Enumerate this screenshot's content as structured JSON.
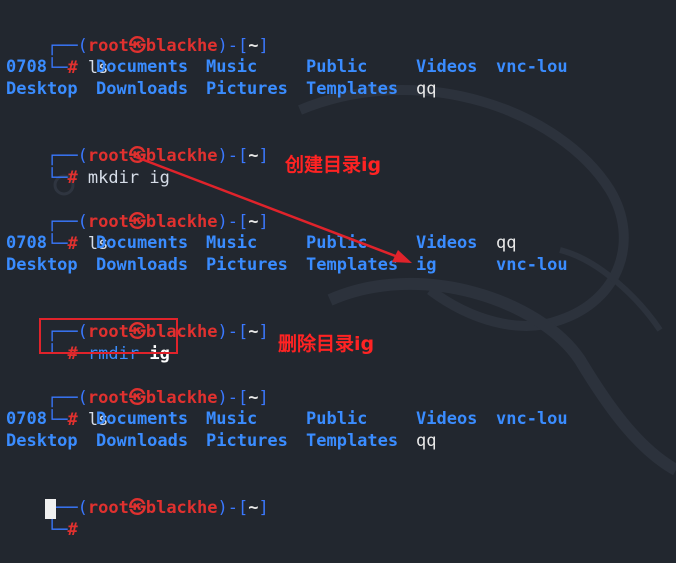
{
  "prompt": {
    "frame_top": "┌──(",
    "frame_bot": "└─",
    "user": "root㉿blackhe",
    "mid": ")-[",
    "dir": "~",
    "end": "]",
    "hash": "# "
  },
  "blocks": [
    {
      "cmd": "ls",
      "arg": ""
    },
    {
      "cmd": "mkdir ",
      "arg": "ig"
    },
    {
      "cmd": "ls",
      "arg": ""
    },
    {
      "cmd": "rmdir ",
      "arg": "ig"
    },
    {
      "cmd": "ls",
      "arg": ""
    },
    {
      "cmd": "",
      "arg": ""
    }
  ],
  "listing1": {
    "row1": [
      "0708",
      "Documents",
      "Music",
      "Public",
      "Videos",
      "vnc-lou"
    ],
    "row2": [
      "Desktop",
      "Downloads",
      "Pictures",
      "Templates",
      "qq"
    ]
  },
  "listing2": {
    "row1": [
      "0708",
      "Documents",
      "Music",
      "Public",
      "Videos",
      "qq"
    ],
    "row2": [
      "Desktop",
      "Downloads",
      "Pictures",
      "Templates",
      "ig",
      "vnc-lou"
    ]
  },
  "listing3": {
    "row1": [
      "0708",
      "Documents",
      "Music",
      "Public",
      "Videos",
      "vnc-lou"
    ],
    "row2": [
      "Desktop",
      "Downloads",
      "Pictures",
      "Templates",
      "qq"
    ]
  },
  "annotations": {
    "create": "创建目录ig",
    "delete": "删除目录ig"
  },
  "colors": {
    "background": "#22272f",
    "prompt_frame": "#3a78ff",
    "user": "#e0312f",
    "directory": "#3a8cff",
    "annotation": "#ff2323"
  }
}
